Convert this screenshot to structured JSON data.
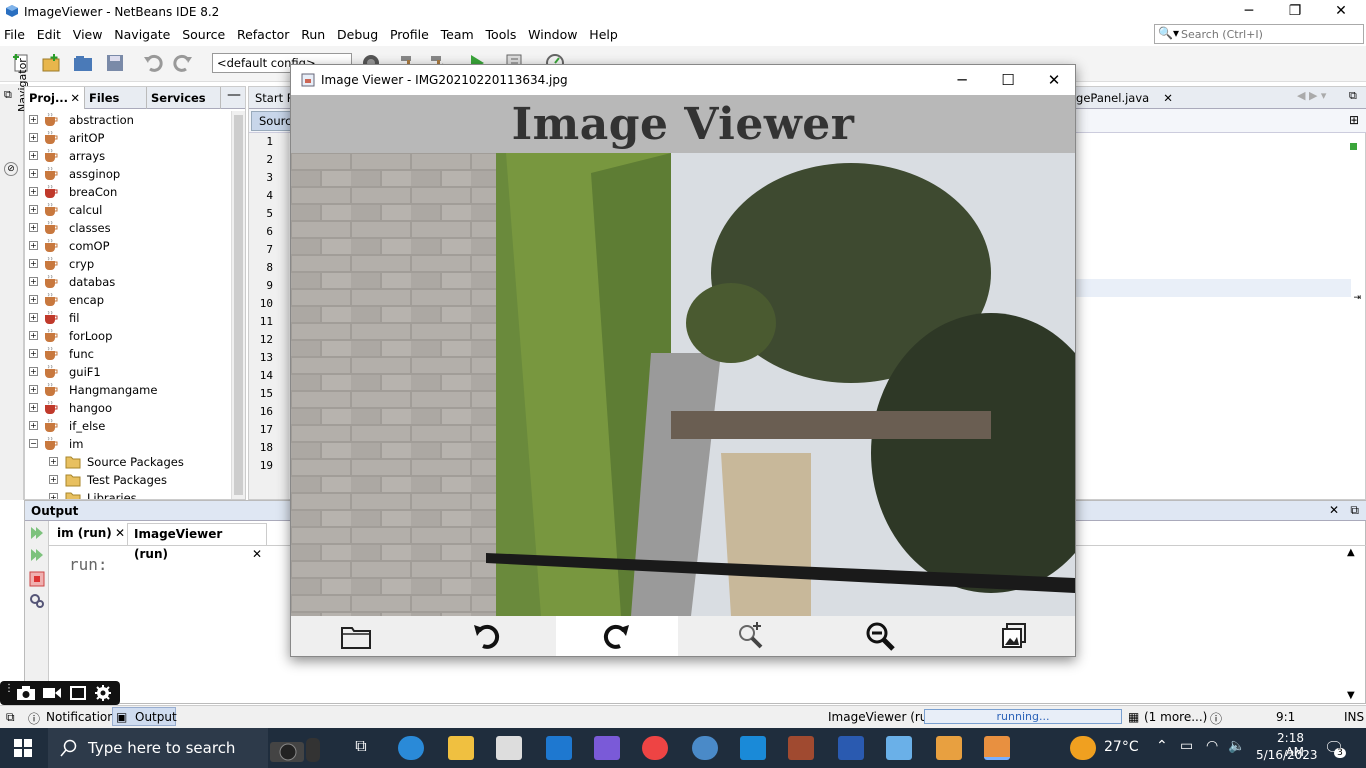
{
  "ide": {
    "title": "ImageViewer - NetBeans IDE 8.2",
    "menu": [
      "File",
      "Edit",
      "View",
      "Navigate",
      "Source",
      "Refactor",
      "Run",
      "Debug",
      "Profile",
      "Team",
      "Tools",
      "Window",
      "Help"
    ],
    "search_placeholder": "Search (Ctrl+I)",
    "config": "<default config>",
    "navigator_label": "Navigator",
    "project_tabs": [
      "Proj...",
      "Files",
      "Services"
    ],
    "projects": [
      "abstraction",
      "aritOP",
      "arrays",
      "assginop",
      "breaCon",
      "calcul",
      "classes",
      "comOP",
      "cryp",
      "databas",
      "encap",
      "fil",
      "forLoop",
      "func",
      "guiF1",
      "Hangmangame",
      "hangoo",
      "if_else",
      "im"
    ],
    "sub_items": [
      "Source Packages",
      "Test Packages",
      "Libraries"
    ],
    "editor_tabs": {
      "start": "Start P",
      "file": "agePanel.java"
    },
    "source_label": "Source",
    "line_numbers": [
      "1",
      "2",
      "3",
      "4",
      "5",
      "6",
      "7",
      "8",
      "9",
      "10",
      "11",
      "12",
      "13",
      "14",
      "15",
      "16",
      "17",
      "18",
      "19"
    ]
  },
  "output": {
    "title": "Output",
    "tabs": [
      "im (run)",
      "ImageViewer (run)"
    ],
    "text": "run:"
  },
  "status": {
    "notifications": "Notifications",
    "output": "Output",
    "process": "ImageViewer (run)",
    "progress": "running...",
    "more": "(1 more...)",
    "position": "9:1",
    "mode": "INS"
  },
  "taskbar": {
    "search": "Type here to search",
    "temp": "27°C",
    "time": "2:18 AM",
    "date": "5/16/2023",
    "notif_count": "3"
  },
  "viewer": {
    "window_title": "Image Viewer - IMG20210220113634.jpg",
    "heading": "Image Viewer",
    "tools": [
      "open-folder",
      "rotate-left",
      "rotate-right",
      "zoom-in",
      "zoom-out",
      "gallery"
    ]
  },
  "colors": {
    "header_bg": "#b8b8b8",
    "accent_blue": "#2c63b8",
    "taskbar": "#1f2d3d"
  }
}
